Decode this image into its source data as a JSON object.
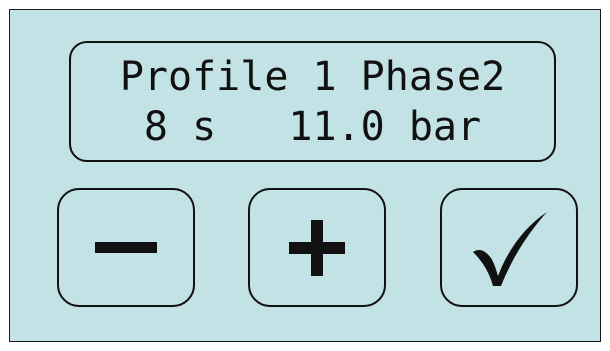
{
  "display": {
    "line1": "Profile 1 Phase2",
    "line2": "8 s   11.0 bar"
  },
  "buttons": {
    "minus": {
      "icon": "minus-icon"
    },
    "plus": {
      "icon": "plus-icon"
    },
    "confirm": {
      "icon": "check-icon"
    }
  },
  "colors": {
    "background": "#c2e2e6",
    "foreground": "#111111"
  }
}
